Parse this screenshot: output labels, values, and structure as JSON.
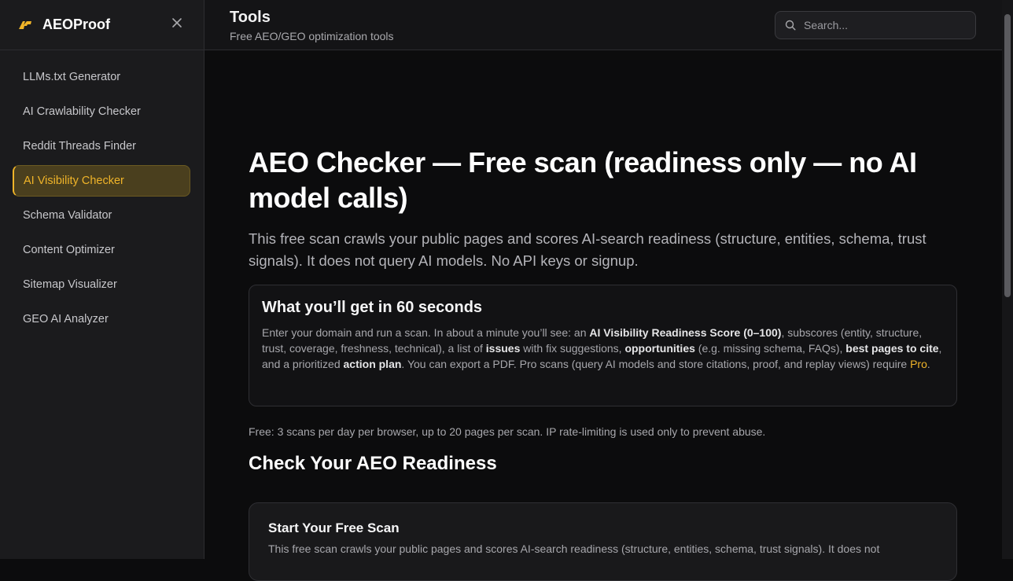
{
  "brand": {
    "name": "AEOProof",
    "logo_text": "AP"
  },
  "sidebar": {
    "items": [
      {
        "label": "LLMs.txt Generator"
      },
      {
        "label": "AI Crawlability Checker"
      },
      {
        "label": "Reddit Threads Finder"
      },
      {
        "label": "AI Visibility Checker",
        "active": true
      },
      {
        "label": "Schema Validator"
      },
      {
        "label": "Content Optimizer"
      },
      {
        "label": "Sitemap Visualizer"
      },
      {
        "label": "GEO AI Analyzer"
      }
    ]
  },
  "header": {
    "title": "Tools",
    "subtitle": "Free AEO/GEO optimization tools",
    "search_placeholder": "Search..."
  },
  "main": {
    "heading": "AEO Checker — Free scan (readiness only — no AI model calls)",
    "lead": "This free scan crawls your public pages and scores AI-search readiness (structure, entities, schema, trust signals). It does not query AI models. No API keys or signup.",
    "card": {
      "title": "What you’ll get in 60 seconds",
      "t1": "Enter your domain and run a scan. In about a minute you’ll see: an ",
      "b1": "AI Visibility Readiness Score (0–100)",
      "t2": ", subscores (entity, structure, trust, coverage, freshness, technical), a list of ",
      "b2": "issues",
      "t3": " with fix suggestions, ",
      "b3": "opportunities",
      "t4": " (e.g. missing schema, FAQs), ",
      "b4": "best pages to cite",
      "t5": ", and a prioritized ",
      "b5": "action plan",
      "t6": ". You can export a PDF. Pro scans (query AI models and store citations, proof, and replay views) require ",
      "link": "Pro",
      "t7": "."
    },
    "limits": "Free: 3 scans per day per browser, up to 20 pages per scan. IP rate-limiting is used only to prevent abuse.",
    "section_title": "Check Your AEO Readiness",
    "scan_card": {
      "title": "Start Your Free Scan",
      "desc": "This free scan crawls your public pages and scores AI-search readiness (structure, entities, schema, trust signals). It does not"
    }
  },
  "colors": {
    "accent": "#f0b429",
    "background": "#0c0c0d",
    "sidebar": "#1b1b1d"
  }
}
